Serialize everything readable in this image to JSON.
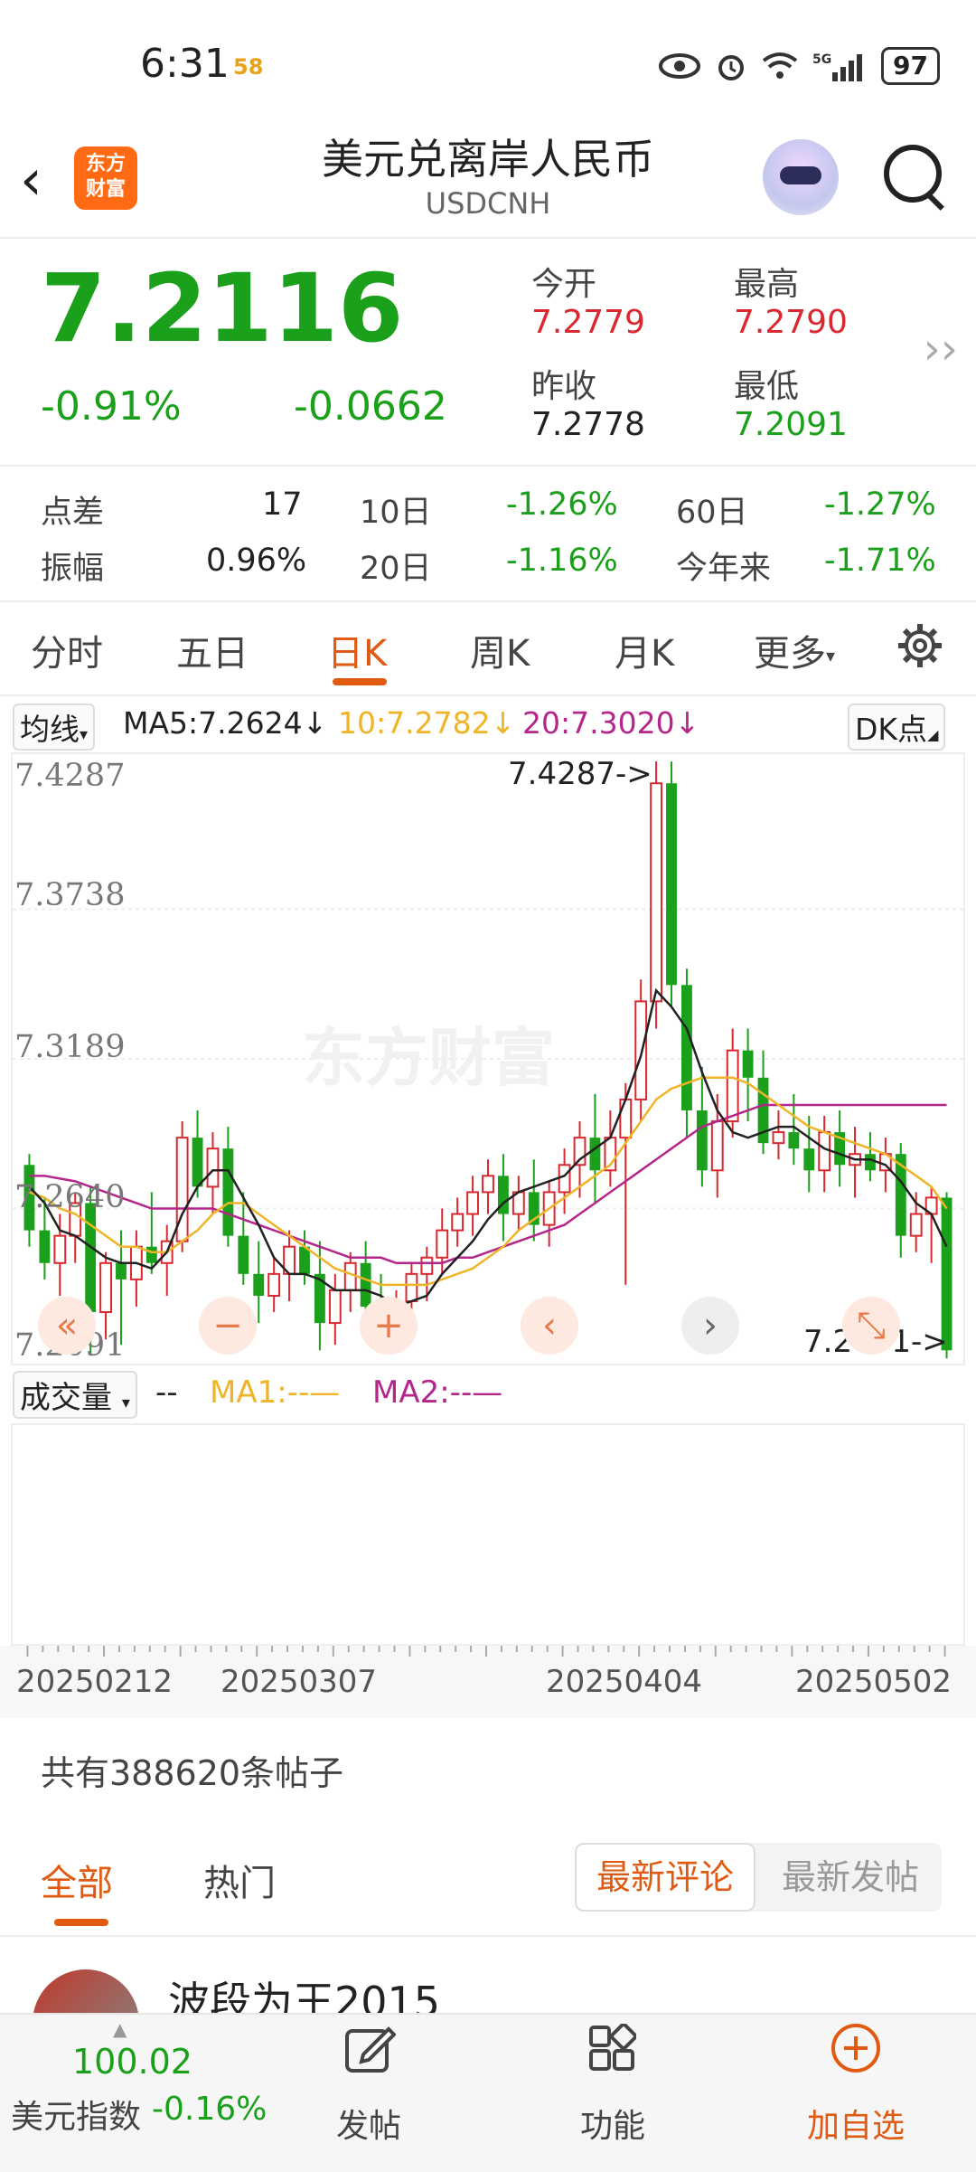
{
  "status_bar": {
    "time": "6:31",
    "badge": "58",
    "battery": "97",
    "network": "5G"
  },
  "header": {
    "title": "美元兑离岸人民币",
    "subtitle": "USDCNH",
    "logo_text_1": "东方",
    "logo_text_2": "财富"
  },
  "quote": {
    "price": "7.2116",
    "change_pct": "-0.91%",
    "change_abs": "-0.0662",
    "open_label": "今开",
    "open_value": "7.2779",
    "high_label": "最高",
    "high_value": "7.2790",
    "prev_close_label": "昨收",
    "prev_close_value": "7.2778",
    "low_label": "最低",
    "low_value": "7.2091"
  },
  "stats": {
    "spread_label": "点差",
    "spread_value": "17",
    "amp_label": "振幅",
    "amp_value": "0.96%",
    "d10_label": "10日",
    "d10_value": "-1.26%",
    "d20_label": "20日",
    "d20_value": "-1.16%",
    "d60_label": "60日",
    "d60_value": "-1.27%",
    "ytd_label": "今年来",
    "ytd_value": "-1.71%"
  },
  "tabs": {
    "t1": "分时",
    "t2": "五日",
    "t3": "日K",
    "t4": "周K",
    "t5": "月K",
    "t6": "更多"
  },
  "ma_bar": {
    "select": "均线",
    "ma5": "MA5:7.2624",
    "ma10": "10:7.2782",
    "ma20": "20:7.3020",
    "dk": "DK点"
  },
  "chart": {
    "y_labels": [
      "7.4287",
      "7.3738",
      "7.3189",
      "7.2640",
      "7.2091"
    ],
    "high_marker": "7.4287->",
    "low_marker": "7.2091->",
    "watermark": "东方财富",
    "colors": {
      "up": "#d9282f",
      "down": "#1aa01a",
      "ma5": "#222222",
      "ma10": "#f0b429",
      "ma20": "#b5268a"
    }
  },
  "chart_data": {
    "type": "candlestick",
    "ylim": [
      7.2091,
      7.4287
    ],
    "ohlc": [
      [
        7.28,
        7.284,
        7.25,
        7.256
      ],
      [
        7.256,
        7.268,
        7.238,
        7.244
      ],
      [
        7.244,
        7.262,
        7.232,
        7.254
      ],
      [
        7.254,
        7.27,
        7.244,
        7.266
      ],
      [
        7.266,
        7.272,
        7.21,
        7.226
      ],
      [
        7.226,
        7.248,
        7.216,
        7.244
      ],
      [
        7.244,
        7.256,
        7.214,
        7.238
      ],
      [
        7.238,
        7.256,
        7.228,
        7.25
      ],
      [
        7.25,
        7.27,
        7.24,
        7.244
      ],
      [
        7.244,
        7.258,
        7.232,
        7.252
      ],
      [
        7.252,
        7.296,
        7.248,
        7.29
      ],
      [
        7.29,
        7.3,
        7.268,
        7.272
      ],
      [
        7.272,
        7.292,
        7.262,
        7.286
      ],
      [
        7.286,
        7.294,
        7.25,
        7.254
      ],
      [
        7.254,
        7.27,
        7.236,
        7.24
      ],
      [
        7.24,
        7.252,
        7.222,
        7.232
      ],
      [
        7.232,
        7.246,
        7.226,
        7.24
      ],
      [
        7.24,
        7.256,
        7.23,
        7.25
      ],
      [
        7.25,
        7.256,
        7.236,
        7.24
      ],
      [
        7.24,
        7.252,
        7.212,
        7.222
      ],
      [
        7.222,
        7.24,
        7.214,
        7.234
      ],
      [
        7.234,
        7.248,
        7.226,
        7.244
      ],
      [
        7.244,
        7.252,
        7.22,
        7.228
      ],
      [
        7.228,
        7.24,
        7.216,
        7.22
      ],
      [
        7.22,
        7.234,
        7.216,
        7.23
      ],
      [
        7.23,
        7.244,
        7.222,
        7.24
      ],
      [
        7.24,
        7.25,
        7.23,
        7.246
      ],
      [
        7.246,
        7.264,
        7.24,
        7.256
      ],
      [
        7.256,
        7.268,
        7.25,
        7.262
      ],
      [
        7.262,
        7.276,
        7.254,
        7.27
      ],
      [
        7.27,
        7.282,
        7.262,
        7.276
      ],
      [
        7.276,
        7.284,
        7.252,
        7.262
      ],
      [
        7.262,
        7.276,
        7.256,
        7.27
      ],
      [
        7.27,
        7.282,
        7.252,
        7.258
      ],
      [
        7.258,
        7.274,
        7.25,
        7.27
      ],
      [
        7.27,
        7.286,
        7.262,
        7.28
      ],
      [
        7.28,
        7.296,
        7.268,
        7.29
      ],
      [
        7.29,
        7.306,
        7.266,
        7.278
      ],
      [
        7.278,
        7.3,
        7.272,
        7.29
      ],
      [
        7.29,
        7.31,
        7.236,
        7.304
      ],
      [
        7.304,
        7.348,
        7.296,
        7.34
      ],
      [
        7.34,
        7.428,
        7.33,
        7.42
      ],
      [
        7.42,
        7.428,
        7.338,
        7.346
      ],
      [
        7.346,
        7.352,
        7.29,
        7.3
      ],
      [
        7.3,
        7.316,
        7.272,
        7.278
      ],
      [
        7.278,
        7.306,
        7.268,
        7.296
      ],
      [
        7.296,
        7.33,
        7.29,
        7.322
      ],
      [
        7.322,
        7.33,
        7.296,
        7.312
      ],
      [
        7.312,
        7.322,
        7.284,
        7.288
      ],
      [
        7.288,
        7.3,
        7.282,
        7.292
      ],
      [
        7.292,
        7.306,
        7.28,
        7.286
      ],
      [
        7.286,
        7.298,
        7.27,
        7.278
      ],
      [
        7.278,
        7.298,
        7.27,
        7.292
      ],
      [
        7.292,
        7.3,
        7.272,
        7.28
      ],
      [
        7.28,
        7.294,
        7.268,
        7.284
      ],
      [
        7.284,
        7.292,
        7.274,
        7.278
      ],
      [
        7.278,
        7.29,
        7.27,
        7.284
      ],
      [
        7.284,
        7.288,
        7.246,
        7.254
      ],
      [
        7.254,
        7.27,
        7.248,
        7.262
      ],
      [
        7.262,
        7.272,
        7.244,
        7.268
      ],
      [
        7.268,
        7.27,
        7.209,
        7.212
      ]
    ],
    "ma5": [
      7.272,
      7.266,
      7.256,
      7.254,
      7.25,
      7.246,
      7.244,
      7.244,
      7.242,
      7.248,
      7.262,
      7.272,
      7.278,
      7.278,
      7.268,
      7.258,
      7.246,
      7.24,
      7.24,
      7.238,
      7.234,
      7.234,
      7.234,
      7.232,
      7.228,
      7.23,
      7.232,
      7.24,
      7.246,
      7.252,
      7.26,
      7.266,
      7.27,
      7.272,
      7.274,
      7.276,
      7.282,
      7.286,
      7.29,
      7.304,
      7.32,
      7.344,
      7.338,
      7.33,
      7.314,
      7.3,
      7.292,
      7.29,
      7.292,
      7.294,
      7.294,
      7.29,
      7.286,
      7.284,
      7.282,
      7.282,
      7.28,
      7.274,
      7.266,
      7.262,
      7.25
    ],
    "ma10": [
      7.27,
      7.268,
      7.264,
      7.262,
      7.258,
      7.254,
      7.25,
      7.25,
      7.248,
      7.248,
      7.252,
      7.256,
      7.262,
      7.266,
      7.266,
      7.262,
      7.258,
      7.254,
      7.25,
      7.246,
      7.242,
      7.24,
      7.238,
      7.236,
      7.236,
      7.236,
      7.236,
      7.238,
      7.24,
      7.242,
      7.246,
      7.25,
      7.256,
      7.26,
      7.264,
      7.268,
      7.272,
      7.276,
      7.28,
      7.288,
      7.296,
      7.304,
      7.308,
      7.31,
      7.312,
      7.312,
      7.312,
      7.31,
      7.306,
      7.302,
      7.298,
      7.294,
      7.292,
      7.29,
      7.288,
      7.286,
      7.284,
      7.28,
      7.276,
      7.272,
      7.264
    ],
    "ma20": [
      7.276,
      7.276,
      7.275,
      7.274,
      7.272,
      7.27,
      7.268,
      7.266,
      7.264,
      7.264,
      7.264,
      7.264,
      7.264,
      7.262,
      7.26,
      7.258,
      7.256,
      7.254,
      7.252,
      7.25,
      7.248,
      7.246,
      7.246,
      7.246,
      7.244,
      7.244,
      7.244,
      7.244,
      7.246,
      7.246,
      7.248,
      7.25,
      7.252,
      7.254,
      7.256,
      7.258,
      7.262,
      7.266,
      7.27,
      7.274,
      7.278,
      7.282,
      7.286,
      7.29,
      7.294,
      7.296,
      7.298,
      7.3,
      7.302,
      7.302,
      7.302,
      7.302,
      7.302,
      7.302,
      7.302,
      7.302,
      7.302,
      7.302,
      7.302,
      7.302,
      7.302
    ]
  },
  "volume": {
    "select": "成交量",
    "dash": "--",
    "ma1": "MA1:--",
    "ma2": "MA2:--"
  },
  "dates": [
    "20250212",
    "20250307",
    "20250404",
    "20250502"
  ],
  "community": {
    "post_count": "共有388620条帖子",
    "tab_all": "全部",
    "tab_hot": "热门",
    "sort_latest_comment": "最新评论",
    "sort_latest_post": "最新发帖",
    "author": "波段为王2015"
  },
  "bottom_nav": {
    "index_value": "100.02",
    "index_label": "美元指数",
    "index_change": "-0.16%",
    "post": "发帖",
    "func": "功能",
    "add": "加自选"
  }
}
